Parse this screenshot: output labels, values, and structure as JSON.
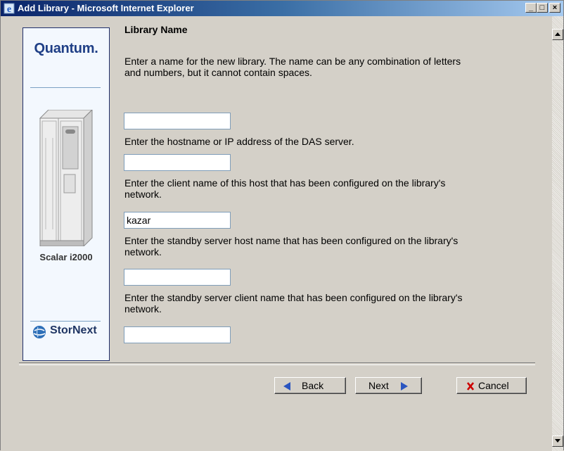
{
  "window": {
    "title": "Add Library - Microsoft Internet Explorer",
    "minimize_symbol": "_",
    "maximize_symbol": "□",
    "close_symbol": "×"
  },
  "sidebar": {
    "brand_logo": "Quantum.",
    "product_name": "Scalar i2000",
    "footer_logo": "StorNext",
    "icons": [
      "library-cabinet-icon",
      "stornext-globe-icon"
    ]
  },
  "form": {
    "heading": "Library Name",
    "fields": [
      {
        "prompt": "Enter a name for the new library. The name can be any combination of letters and numbers, but it cannot contain spaces.",
        "value": ""
      },
      {
        "prompt": "Enter the hostname or IP address of the DAS server.",
        "value": ""
      },
      {
        "prompt": "Enter the client name of this host that has been configured on the library's network.",
        "value": "kazar"
      },
      {
        "prompt": "Enter the standby server host name that has been configured on the library's network.",
        "value": ""
      },
      {
        "prompt": "Enter the standby server client name that has been configured on the library's network.",
        "value": ""
      }
    ]
  },
  "buttons": {
    "back": "Back",
    "next": "Next",
    "cancel": "Cancel"
  },
  "colors": {
    "titlebar": "#0a246a",
    "dialog_bg": "#d4d0c8",
    "sidebar_bg": "#f3f8fe",
    "brand_blue": "#1f3f86",
    "arrow_blue": "#2a55c0",
    "cancel_red": "#cc0000"
  }
}
